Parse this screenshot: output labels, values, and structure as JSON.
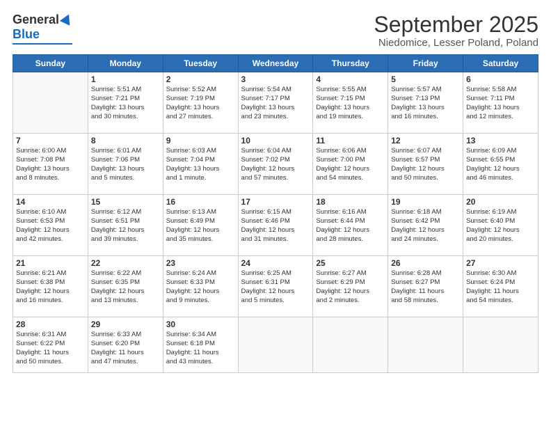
{
  "logo": {
    "general": "General",
    "blue": "Blue"
  },
  "title": "September 2025",
  "location": "Niedomice, Lesser Poland, Poland",
  "days": [
    "Sunday",
    "Monday",
    "Tuesday",
    "Wednesday",
    "Thursday",
    "Friday",
    "Saturday"
  ],
  "weeks": [
    [
      {
        "day": "",
        "info": ""
      },
      {
        "day": "1",
        "info": "Sunrise: 5:51 AM\nSunset: 7:21 PM\nDaylight: 13 hours\nand 30 minutes."
      },
      {
        "day": "2",
        "info": "Sunrise: 5:52 AM\nSunset: 7:19 PM\nDaylight: 13 hours\nand 27 minutes."
      },
      {
        "day": "3",
        "info": "Sunrise: 5:54 AM\nSunset: 7:17 PM\nDaylight: 13 hours\nand 23 minutes."
      },
      {
        "day": "4",
        "info": "Sunrise: 5:55 AM\nSunset: 7:15 PM\nDaylight: 13 hours\nand 19 minutes."
      },
      {
        "day": "5",
        "info": "Sunrise: 5:57 AM\nSunset: 7:13 PM\nDaylight: 13 hours\nand 16 minutes."
      },
      {
        "day": "6",
        "info": "Sunrise: 5:58 AM\nSunset: 7:11 PM\nDaylight: 13 hours\nand 12 minutes."
      }
    ],
    [
      {
        "day": "7",
        "info": "Sunrise: 6:00 AM\nSunset: 7:08 PM\nDaylight: 13 hours\nand 8 minutes."
      },
      {
        "day": "8",
        "info": "Sunrise: 6:01 AM\nSunset: 7:06 PM\nDaylight: 13 hours\nand 5 minutes."
      },
      {
        "day": "9",
        "info": "Sunrise: 6:03 AM\nSunset: 7:04 PM\nDaylight: 13 hours\nand 1 minute."
      },
      {
        "day": "10",
        "info": "Sunrise: 6:04 AM\nSunset: 7:02 PM\nDaylight: 12 hours\nand 57 minutes."
      },
      {
        "day": "11",
        "info": "Sunrise: 6:06 AM\nSunset: 7:00 PM\nDaylight: 12 hours\nand 54 minutes."
      },
      {
        "day": "12",
        "info": "Sunrise: 6:07 AM\nSunset: 6:57 PM\nDaylight: 12 hours\nand 50 minutes."
      },
      {
        "day": "13",
        "info": "Sunrise: 6:09 AM\nSunset: 6:55 PM\nDaylight: 12 hours\nand 46 minutes."
      }
    ],
    [
      {
        "day": "14",
        "info": "Sunrise: 6:10 AM\nSunset: 6:53 PM\nDaylight: 12 hours\nand 42 minutes."
      },
      {
        "day": "15",
        "info": "Sunrise: 6:12 AM\nSunset: 6:51 PM\nDaylight: 12 hours\nand 39 minutes."
      },
      {
        "day": "16",
        "info": "Sunrise: 6:13 AM\nSunset: 6:49 PM\nDaylight: 12 hours\nand 35 minutes."
      },
      {
        "day": "17",
        "info": "Sunrise: 6:15 AM\nSunset: 6:46 PM\nDaylight: 12 hours\nand 31 minutes."
      },
      {
        "day": "18",
        "info": "Sunrise: 6:16 AM\nSunset: 6:44 PM\nDaylight: 12 hours\nand 28 minutes."
      },
      {
        "day": "19",
        "info": "Sunrise: 6:18 AM\nSunset: 6:42 PM\nDaylight: 12 hours\nand 24 minutes."
      },
      {
        "day": "20",
        "info": "Sunrise: 6:19 AM\nSunset: 6:40 PM\nDaylight: 12 hours\nand 20 minutes."
      }
    ],
    [
      {
        "day": "21",
        "info": "Sunrise: 6:21 AM\nSunset: 6:38 PM\nDaylight: 12 hours\nand 16 minutes."
      },
      {
        "day": "22",
        "info": "Sunrise: 6:22 AM\nSunset: 6:35 PM\nDaylight: 12 hours\nand 13 minutes."
      },
      {
        "day": "23",
        "info": "Sunrise: 6:24 AM\nSunset: 6:33 PM\nDaylight: 12 hours\nand 9 minutes."
      },
      {
        "day": "24",
        "info": "Sunrise: 6:25 AM\nSunset: 6:31 PM\nDaylight: 12 hours\nand 5 minutes."
      },
      {
        "day": "25",
        "info": "Sunrise: 6:27 AM\nSunset: 6:29 PM\nDaylight: 12 hours\nand 2 minutes."
      },
      {
        "day": "26",
        "info": "Sunrise: 6:28 AM\nSunset: 6:27 PM\nDaylight: 11 hours\nand 58 minutes."
      },
      {
        "day": "27",
        "info": "Sunrise: 6:30 AM\nSunset: 6:24 PM\nDaylight: 11 hours\nand 54 minutes."
      }
    ],
    [
      {
        "day": "28",
        "info": "Sunrise: 6:31 AM\nSunset: 6:22 PM\nDaylight: 11 hours\nand 50 minutes."
      },
      {
        "day": "29",
        "info": "Sunrise: 6:33 AM\nSunset: 6:20 PM\nDaylight: 11 hours\nand 47 minutes."
      },
      {
        "day": "30",
        "info": "Sunrise: 6:34 AM\nSunset: 6:18 PM\nDaylight: 11 hours\nand 43 minutes."
      },
      {
        "day": "",
        "info": ""
      },
      {
        "day": "",
        "info": ""
      },
      {
        "day": "",
        "info": ""
      },
      {
        "day": "",
        "info": ""
      }
    ]
  ]
}
